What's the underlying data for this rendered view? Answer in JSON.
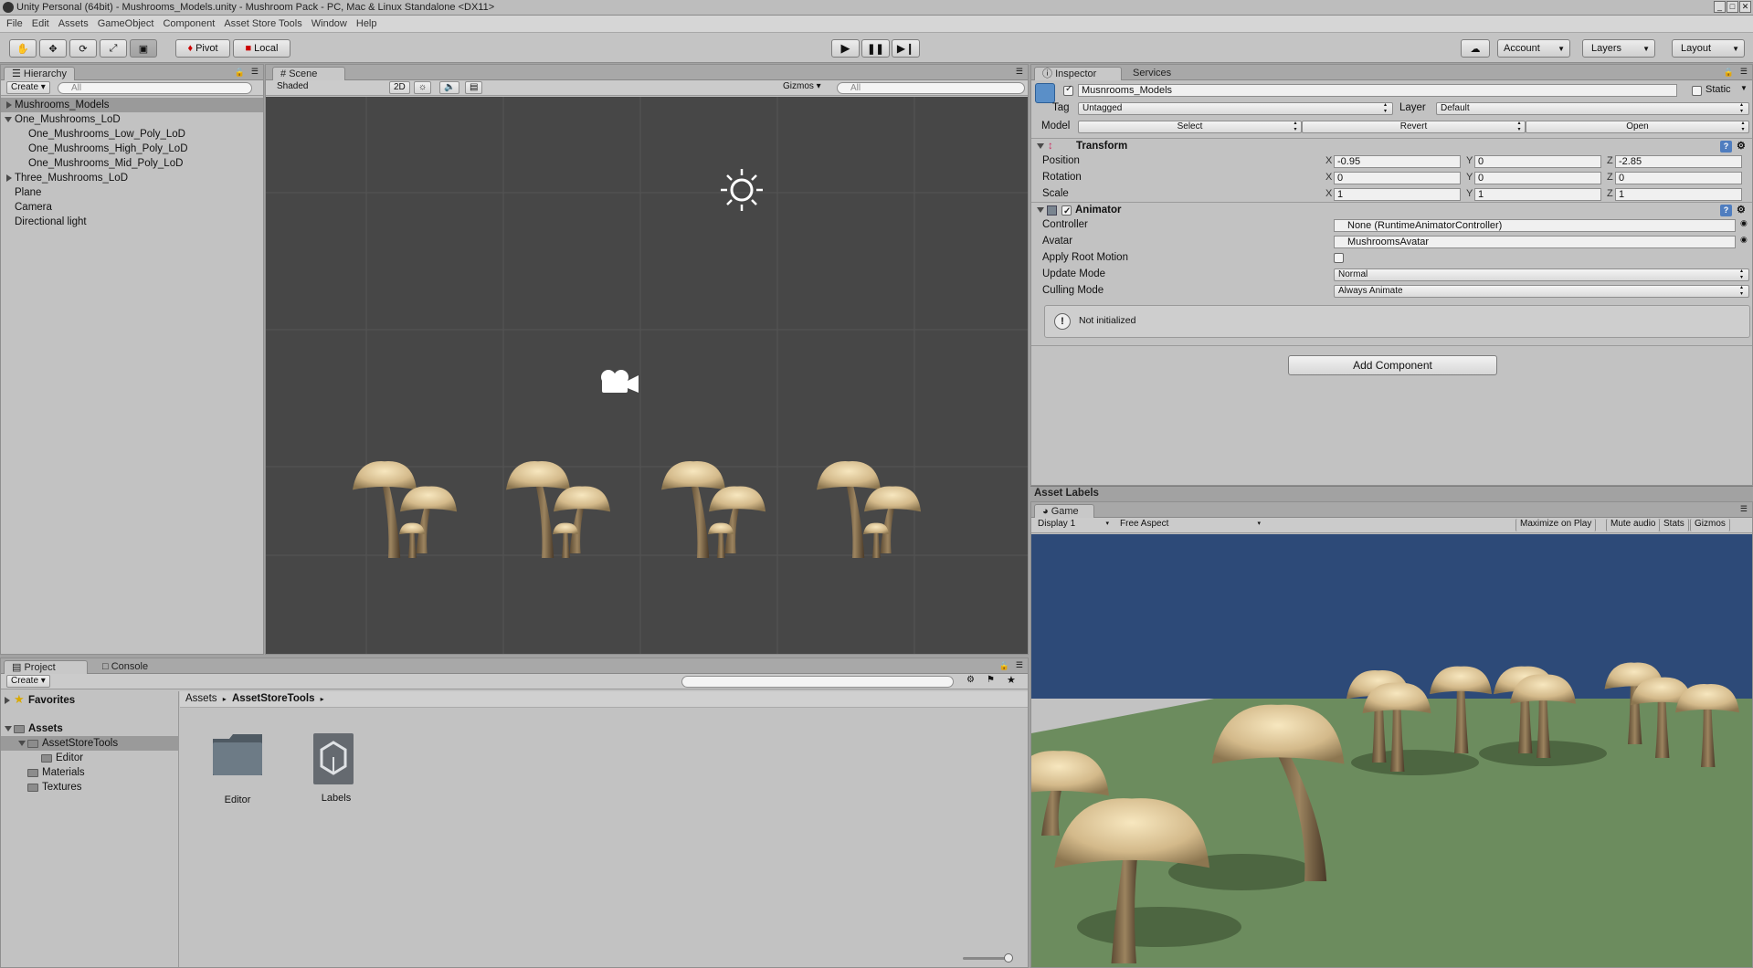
{
  "title": "Unity Personal (64bit) - Mushrooms_Models.unity - Mushroom Pack - PC, Mac & Linux Standalone <DX11>",
  "menu": [
    "File",
    "Edit",
    "Assets",
    "GameObject",
    "Component",
    "Asset Store Tools",
    "Window",
    "Help"
  ],
  "toolbar": {
    "pivot": "Pivot",
    "local": "Local",
    "account": "Account",
    "layers": "Layers",
    "layout": "Layout"
  },
  "hierarchy": {
    "tab": "Hierarchy",
    "create": "Create",
    "search": "All",
    "items": [
      {
        "label": "Mushrooms_Models",
        "depth": 0,
        "arrow": "right",
        "selected": true
      },
      {
        "label": "One_Mushrooms_LoD",
        "depth": 0,
        "arrow": "down"
      },
      {
        "label": "One_Mushrooms_Low_Poly_LoD",
        "depth": 1
      },
      {
        "label": "One_Mushrooms_High_Poly_LoD",
        "depth": 1
      },
      {
        "label": "One_Mushrooms_Mid_Poly_LoD",
        "depth": 1
      },
      {
        "label": "Three_Mushrooms_LoD",
        "depth": 0,
        "arrow": "right"
      },
      {
        "label": "Plane",
        "depth": 0
      },
      {
        "label": "Camera",
        "depth": 0
      },
      {
        "label": "Directional light",
        "depth": 0
      }
    ]
  },
  "scene": {
    "tab": "Scene",
    "shaded": "Shaded",
    "mode2d": "2D",
    "gizmos": "Gizmos",
    "search": "All"
  },
  "project": {
    "tab": "Project",
    "tab2": "Console",
    "create": "Create",
    "tree": [
      {
        "label": "Favorites",
        "depth": 0,
        "bold": true
      },
      {
        "label": "Assets",
        "depth": 0,
        "bold": true
      },
      {
        "label": "AssetStoreTools",
        "depth": 1,
        "selected": true
      },
      {
        "label": "Editor",
        "depth": 2
      },
      {
        "label": "Materials",
        "depth": 1
      },
      {
        "label": "Textures",
        "depth": 1
      }
    ],
    "breadcrumb": [
      "Assets",
      "AssetStoreTools"
    ],
    "assets": [
      {
        "label": "Editor",
        "icon": "folder-icon"
      },
      {
        "label": "Labels",
        "icon": "unity-logo-icon"
      }
    ]
  },
  "inspector": {
    "tab": "Inspector",
    "tab2": "Services",
    "object_name": "Musnrooms_Models",
    "static_label": "Static",
    "tag_label": "Tag",
    "tag_value": "Untagged",
    "layer_label": "Layer",
    "layer_value": "Default",
    "model_label": "Model",
    "model_buttons": [
      "Select",
      "Revert",
      "Open"
    ],
    "transform": {
      "title": "Transform",
      "rows": [
        {
          "label": "Position",
          "x": "-0.95",
          "y": "0",
          "z": "-2.85"
        },
        {
          "label": "Rotation",
          "x": "0",
          "y": "0",
          "z": "0"
        },
        {
          "label": "Scale",
          "x": "1",
          "y": "1",
          "z": "1"
        }
      ]
    },
    "animator": {
      "title": "Animator",
      "controller_label": "Controller",
      "controller_value": "None (RuntimeAnimatorController)",
      "avatar_label": "Avatar",
      "avatar_value": "MushroomsAvatar",
      "root_motion_label": "Apply Root Motion",
      "update_label": "Update Mode",
      "update_value": "Normal",
      "culling_label": "Culling Mode",
      "culling_value": "Always Animate",
      "status": "Not initialized"
    },
    "add_component": "Add Component",
    "asset_labels": "Asset Labels"
  },
  "game": {
    "tab": "Game",
    "display": "Display 1",
    "aspect": "Free Aspect",
    "options": [
      "Maximize on Play",
      "Mute audio",
      "Stats",
      "Gizmos"
    ]
  },
  "colors": {
    "panel": "#c2c2c2",
    "scene_bg": "#474747",
    "sky": "#2f4c7a",
    "ground": "#6f8f5f",
    "selection": "#9a9a9a"
  }
}
